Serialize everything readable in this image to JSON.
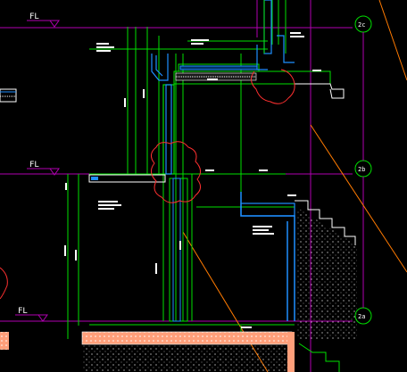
{
  "drawing": {
    "background": "#000000",
    "colors": {
      "level_line": "#b000b0",
      "dim_line": "#00e000",
      "wall": "#1f8fff",
      "cloud": "#ff3030",
      "white": "#ffffff",
      "slope": "#ff7a00",
      "hatch": "#ffffff"
    },
    "levels": [
      {
        "id": "top",
        "fl_label": "FL",
        "grid_bubble": "2c"
      },
      {
        "id": "mid",
        "fl_label": "FL",
        "grid_bubble": "2b"
      },
      {
        "id": "bottom",
        "fl_label": "FL",
        "grid_bubble": "2a"
      }
    ]
  }
}
